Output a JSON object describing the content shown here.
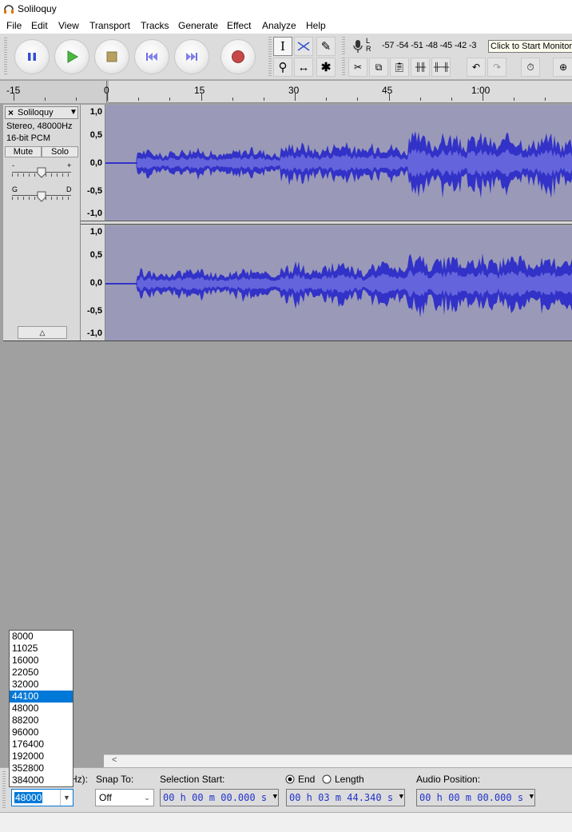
{
  "window": {
    "title": "Soliloquy",
    "icon": "headphones-icon"
  },
  "menu": [
    "File",
    "Edit",
    "View",
    "Transport",
    "Tracks",
    "Generate",
    "Effect",
    "Analyze",
    "Help"
  ],
  "transport": {
    "pause": "pause-icon",
    "play": "play-icon",
    "stop": "stop-icon",
    "skip_start": "skip-to-start-icon",
    "skip_end": "skip-to-end-icon",
    "record": "record-icon"
  },
  "meter": {
    "scale": "-57 -54 -51 -48 -45 -42 -3",
    "tooltip": "Click to Start Monitoring",
    "channels": [
      "L",
      "R"
    ]
  },
  "ruler": {
    "labels": [
      {
        "text": "-15"
      },
      {
        "text": "0"
      },
      {
        "text": "15"
      },
      {
        "text": "30"
      },
      {
        "text": "45"
      },
      {
        "text": "1:00"
      }
    ]
  },
  "track": {
    "name": "Soliloquy",
    "info_line1": "Stereo, 48000Hz",
    "info_line2": "16-bit PCM",
    "mute": "Mute",
    "solo": "Solo",
    "gain_left": "-",
    "gain_right": "+",
    "pan_left": "G",
    "pan_right": "D",
    "amplitude_labels": [
      "1,0",
      "0,5",
      "0,0",
      "-0,5",
      "-1,0"
    ]
  },
  "bottom": {
    "rate_label": "Hz):",
    "rate_value": "48000",
    "snap_label": "Snap To:",
    "snap_value": "Off",
    "selection_start_label": "Selection Start:",
    "selection_start": "00 h 00 m 00.000 s",
    "end_label": "End",
    "length_label": "Length",
    "end_value": "00 h 03 m 44.340 s",
    "audio_position_label": "Audio Position:",
    "audio_position": "00 h 00 m 00.000 s"
  },
  "rate_options": [
    "8000",
    "11025",
    "16000",
    "22050",
    "32000",
    "44100",
    "48000",
    "88200",
    "96000",
    "176400",
    "192000",
    "352800",
    "384000"
  ],
  "rate_highlighted": "44100",
  "colors": {
    "waveform": "#3232c8",
    "waveform_rms": "#6464dc",
    "wave_bg": "#9a9ab8",
    "selection": "#0078d7"
  }
}
